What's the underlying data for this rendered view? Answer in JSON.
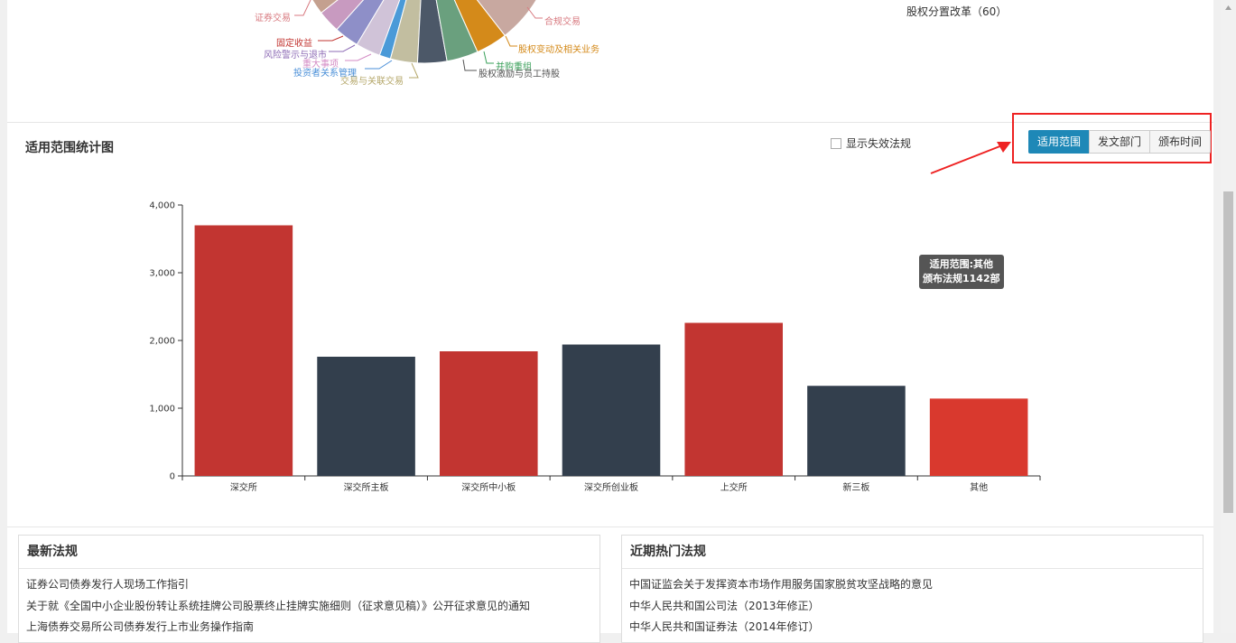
{
  "pie": {
    "left_labels": [
      {
        "text": "证券交易",
        "color": "#d87a80"
      },
      {
        "text": "固定收益",
        "color": "#c23531"
      },
      {
        "text": "风险警示与退市",
        "color": "#8d6bb5"
      },
      {
        "text": "重大事项",
        "color": "#d48bc5"
      },
      {
        "text": "投资者关系管理",
        "color": "#4a8fd8"
      },
      {
        "text": "交易与关联交易",
        "color": "#b5a76a"
      }
    ],
    "right_labels": [
      {
        "text": "合规交易",
        "color": "#d87a80"
      },
      {
        "text": "股权变动及相关业务",
        "color": "#d48a1a"
      },
      {
        "text": "并购重组",
        "color": "#3aa05a"
      },
      {
        "text": "股权激励与员工持股",
        "color": "#555555"
      }
    ],
    "top_legend": "股权分置改革（60）"
  },
  "stats": {
    "title": "适用范围统计图",
    "show_invalid_label": "显示失效法规",
    "tabs": [
      {
        "label": "适用范围",
        "active": true
      },
      {
        "label": "发文部门",
        "active": false
      },
      {
        "label": "颁布时间",
        "active": false
      }
    ]
  },
  "chart_data": {
    "type": "bar",
    "categories": [
      "深交所",
      "深交所主板",
      "深交所中小板",
      "深交所创业板",
      "上交所",
      "新三板",
      "其他"
    ],
    "values": [
      3700,
      1760,
      1840,
      1940,
      2260,
      1330,
      1142
    ],
    "colors": [
      "#c23531",
      "#333f4d",
      "#c23531",
      "#333f4d",
      "#c23531",
      "#333f4d",
      "#d9392e"
    ],
    "ylim": [
      0,
      4000
    ],
    "yticks": [
      0,
      1000,
      2000,
      3000,
      4000
    ],
    "ytick_labels": [
      "0",
      "1,000",
      "2,000",
      "3,000",
      "4,000"
    ],
    "title": "",
    "xlabel": "",
    "ylabel": ""
  },
  "tooltip": {
    "line1": "适用范围:其他",
    "line2": "颁布法规1142部"
  },
  "latest": {
    "title": "最新法规",
    "items": [
      "证券公司债券发行人现场工作指引",
      "关于就《全国中小企业股份转让系统挂牌公司股票终止挂牌实施细则（征求意见稿）》公开征求意见的通知",
      "上海债券交易所公司债券发行上市业务操作指南"
    ]
  },
  "hot": {
    "title": "近期热门法规",
    "items": [
      "中国证监会关于发挥资本市场作用服务国家脱贫攻坚战略的意见",
      "中华人民共和国公司法（2013年修正）",
      "中华人民共和国证券法（2014年修订）"
    ]
  },
  "accent_color": "#1e88b7",
  "highlight_color": "#ee2222"
}
